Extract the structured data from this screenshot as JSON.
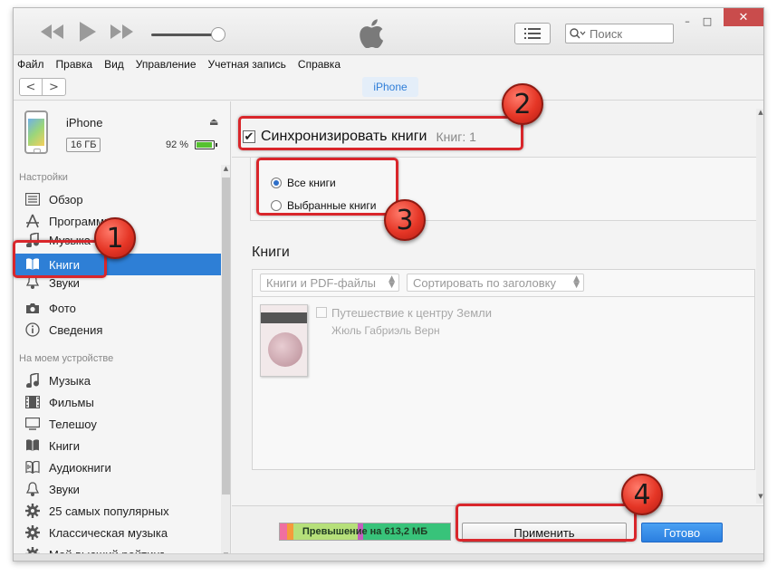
{
  "titlebar": {
    "search_placeholder": "Поиск",
    "minimize": "–",
    "maximize": "□",
    "close": "✕"
  },
  "menu": [
    "Файл",
    "Правка",
    "Вид",
    "Управление",
    "Учетная запись",
    "Справка"
  ],
  "nav": {
    "back": "<",
    "forward": ">",
    "device_tab": "iPhone"
  },
  "device": {
    "name": "iPhone",
    "capacity": "16 ГБ",
    "battery_percent": "92 %",
    "battery_level": 0.92
  },
  "sidebar": {
    "settings_header": "Настройки",
    "settings_items": [
      {
        "label": "Обзор",
        "icon": "summary-icon"
      },
      {
        "label": "Программы",
        "icon": "apps-icon"
      },
      {
        "label": "Музыка",
        "icon": "music-icon"
      },
      {
        "label": "Книги",
        "icon": "books-icon",
        "active": true
      },
      {
        "label": "Звуки",
        "icon": "bell-icon"
      },
      {
        "label": "Фото",
        "icon": "camera-icon"
      },
      {
        "label": "Сведения",
        "icon": "info-icon"
      }
    ],
    "device_header": "На моем устройстве",
    "device_items": [
      {
        "label": "Музыка",
        "icon": "music-icon"
      },
      {
        "label": "Фильмы",
        "icon": "film-icon"
      },
      {
        "label": "Телешоу",
        "icon": "tv-icon"
      },
      {
        "label": "Книги",
        "icon": "books-icon"
      },
      {
        "label": "Аудиокниги",
        "icon": "audiobook-icon"
      },
      {
        "label": "Звуки",
        "icon": "bell-icon"
      },
      {
        "label": "25 самых популярных",
        "icon": "gear-icon"
      },
      {
        "label": "Классическая музыка",
        "icon": "gear-icon"
      },
      {
        "label": "Мой высший рейтинг",
        "icon": "gear-icon"
      }
    ]
  },
  "main": {
    "sync_label": "Синхронизировать книги",
    "sync_count": "Книг: 1",
    "sync_checked": true,
    "radio_all": "Все книги",
    "radio_selected": "Выбранные книги",
    "books_header": "Книги",
    "filter_dropdown": "Книги и PDF-файлы",
    "sort_dropdown": "Сортировать по заголовку",
    "book": {
      "title": "Путешествие к центру Земли",
      "author": "Жюль Габриэль Верн"
    }
  },
  "bottombar": {
    "storage_label": "Превышение на 613,2 МБ",
    "storage_segments": [
      {
        "color": "#f06fa0",
        "fraction": 0.04
      },
      {
        "color": "#f59b3b",
        "fraction": 0.04
      },
      {
        "color": "#b6e07a",
        "fraction": 0.38
      },
      {
        "color": "#c45fbf",
        "fraction": 0.03
      },
      {
        "color": "#38c37a",
        "fraction": 0.51
      }
    ],
    "apply_label": "Применить",
    "done_label": "Готово"
  },
  "annotations": [
    "1",
    "2",
    "3",
    "4"
  ],
  "colors": {
    "accent": "#2e7fd6",
    "highlight": "#d9262b"
  }
}
